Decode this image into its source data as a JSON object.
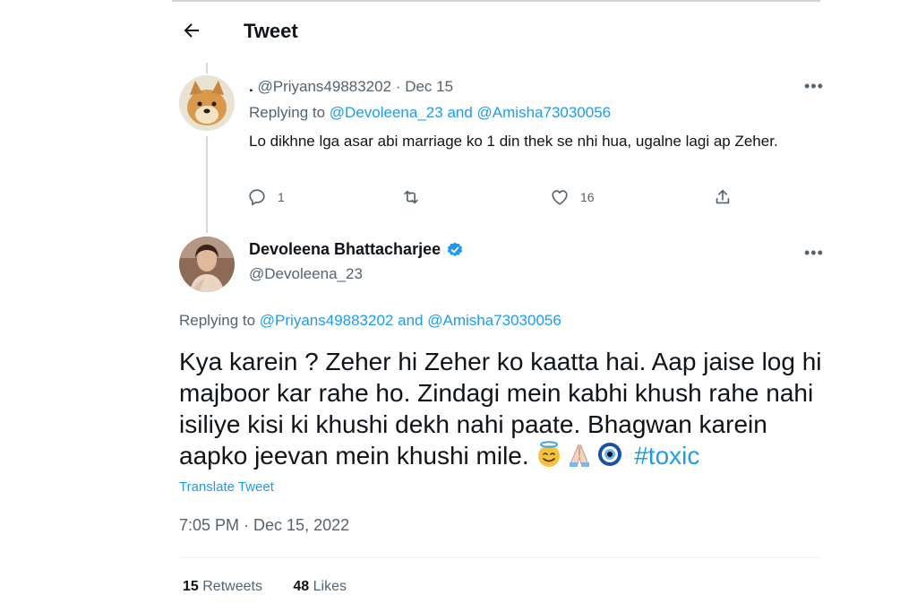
{
  "header": {
    "title": "Tweet",
    "back_icon": "back-arrow-icon"
  },
  "reply": {
    "name": ".",
    "handle": "@Priyans49883202",
    "date": "Dec 15",
    "replying_prefix": "Replying to",
    "replying_to_1": "@Devoleena_23",
    "replying_and": "and",
    "replying_to_2": "@Amisha73030056",
    "text": "Lo dikhne lga asar abi marriage ko 1 din thek se nhi hua, ugalne lagi ap Zeher.",
    "replies": "1",
    "likes": "16"
  },
  "tweet": {
    "author_name": "Devoleena Bhattacharjee",
    "author_handle": "@Devoleena_23",
    "replying_prefix": "Replying to",
    "replying_to_1": "@Priyans49883202",
    "replying_and": "and",
    "replying_to_2": "@Amisha73030056",
    "text": "Kya karein ? Zeher hi Zeher ko kaatta hai. Aap jaise log hi majboor kar rahe ho. Zindagi mein kabhi khush rahe nahi isiliye kisi ki khushi dekh nahi paate. Bhagwan karein aapko jeevan mein khushi mile.",
    "emojis": [
      "smiling-face-with-halo",
      "folded-hands",
      "nazar-amulet"
    ],
    "hashtag": "#toxic",
    "translate_label": "Translate Tweet",
    "timestamp": "7:05 PM · Dec 15, 2022",
    "retweets_count": "15",
    "retweets_label": "Retweets",
    "likes_count": "48",
    "likes_label": "Likes"
  },
  "colors": {
    "accent": "#1d9bf0",
    "muted": "#536471",
    "text": "#0f1419"
  }
}
